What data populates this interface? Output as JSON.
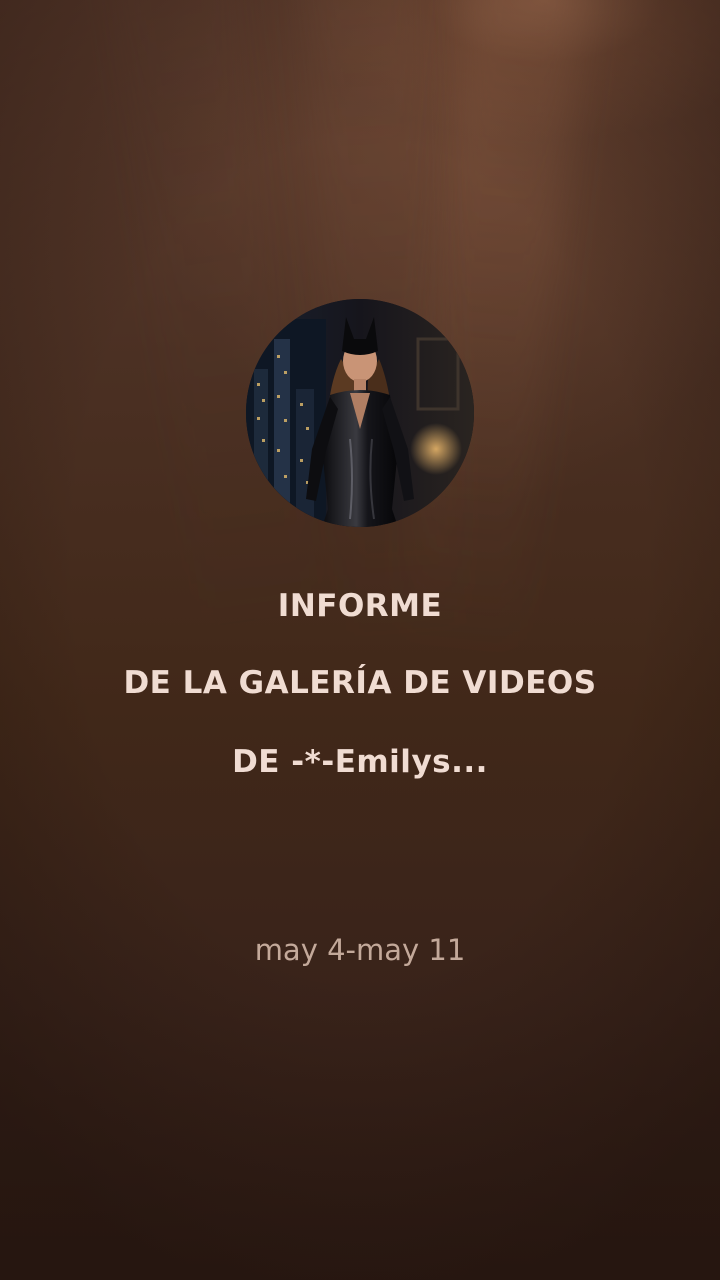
{
  "report": {
    "title_line_1": "INFORME",
    "title_line_2": "DE LA GALERÍA DE VIDEOS",
    "title_line_3": "DE -*-Emilys...",
    "date_range": "may 4-may 11"
  },
  "avatar": {
    "icon": "profile-photo"
  },
  "colors": {
    "background_top": "#5a3a2c",
    "background_bottom": "#2f1c15",
    "title_text": "#f0dcd2",
    "date_text": "#c3a99a"
  }
}
